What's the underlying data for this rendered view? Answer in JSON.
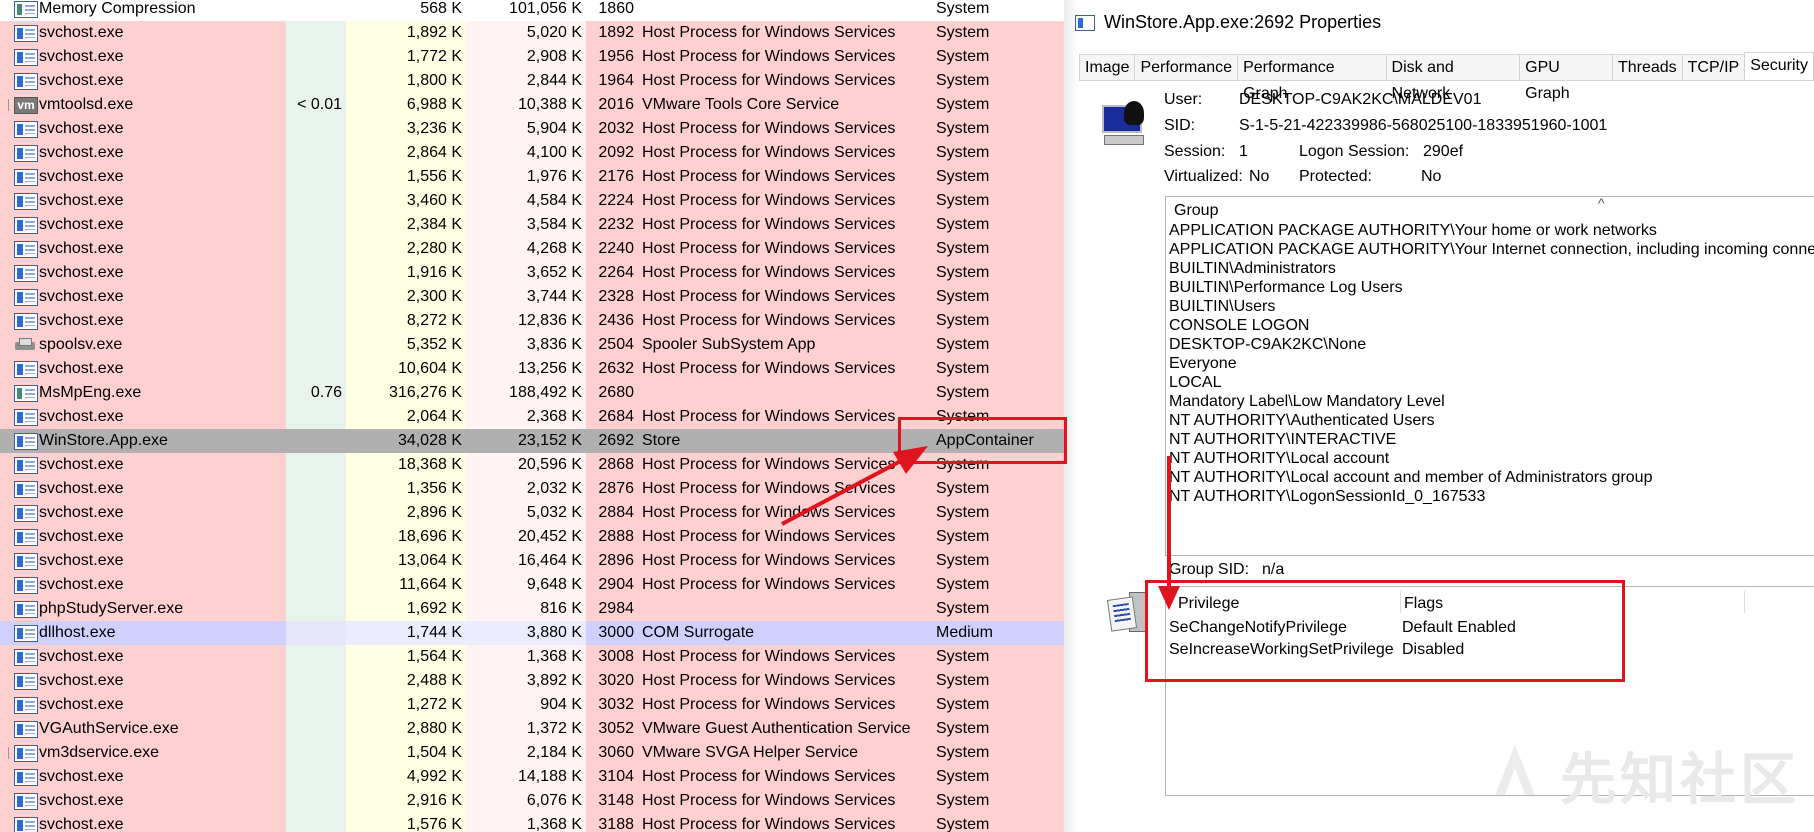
{
  "process_list": {
    "rows": [
      {
        "name": "Memory Compression",
        "cpu": "",
        "private": "568 K",
        "working_set": "101,056 K",
        "pid": "1860",
        "description": "",
        "integrity": "System",
        "style": "white",
        "icon": "plain"
      },
      {
        "name": "svchost.exe",
        "cpu": "",
        "private": "1,892 K",
        "working_set": "5,020 K",
        "pid": "1892",
        "description": "Host Process for Windows Services",
        "integrity": "System",
        "style": "pink",
        "icon": "service"
      },
      {
        "name": "svchost.exe",
        "cpu": "",
        "private": "1,772 K",
        "working_set": "2,908 K",
        "pid": "1956",
        "description": "Host Process for Windows Services",
        "integrity": "System",
        "style": "pink",
        "icon": "service"
      },
      {
        "name": "svchost.exe",
        "cpu": "",
        "private": "1,800 K",
        "working_set": "2,844 K",
        "pid": "1964",
        "description": "Host Process for Windows Services",
        "integrity": "System",
        "style": "pink",
        "icon": "service"
      },
      {
        "name": "vmtoolsd.exe",
        "cpu": "< 0.01",
        "private": "6,988 K",
        "working_set": "10,388 K",
        "pid": "2016",
        "description": "VMware Tools Core Service",
        "integrity": "System",
        "style": "pink",
        "icon": "vm",
        "tree": true
      },
      {
        "name": "svchost.exe",
        "cpu": "",
        "private": "3,236 K",
        "working_set": "5,904 K",
        "pid": "2032",
        "description": "Host Process for Windows Services",
        "integrity": "System",
        "style": "pink",
        "icon": "service"
      },
      {
        "name": "svchost.exe",
        "cpu": "",
        "private": "2,864 K",
        "working_set": "4,100 K",
        "pid": "2092",
        "description": "Host Process for Windows Services",
        "integrity": "System",
        "style": "pink",
        "icon": "service"
      },
      {
        "name": "svchost.exe",
        "cpu": "",
        "private": "1,556 K",
        "working_set": "1,976 K",
        "pid": "2176",
        "description": "Host Process for Windows Services",
        "integrity": "System",
        "style": "pink",
        "icon": "service"
      },
      {
        "name": "svchost.exe",
        "cpu": "",
        "private": "3,460 K",
        "working_set": "4,584 K",
        "pid": "2224",
        "description": "Host Process for Windows Services",
        "integrity": "System",
        "style": "pink",
        "icon": "service"
      },
      {
        "name": "svchost.exe",
        "cpu": "",
        "private": "2,384 K",
        "working_set": "3,584 K",
        "pid": "2232",
        "description": "Host Process for Windows Services",
        "integrity": "System",
        "style": "pink",
        "icon": "service"
      },
      {
        "name": "svchost.exe",
        "cpu": "",
        "private": "2,280 K",
        "working_set": "4,268 K",
        "pid": "2240",
        "description": "Host Process for Windows Services",
        "integrity": "System",
        "style": "pink",
        "icon": "service"
      },
      {
        "name": "svchost.exe",
        "cpu": "",
        "private": "1,916 K",
        "working_set": "3,652 K",
        "pid": "2264",
        "description": "Host Process for Windows Services",
        "integrity": "System",
        "style": "pink",
        "icon": "service"
      },
      {
        "name": "svchost.exe",
        "cpu": "",
        "private": "2,300 K",
        "working_set": "3,744 K",
        "pid": "2328",
        "description": "Host Process for Windows Services",
        "integrity": "System",
        "style": "pink",
        "icon": "service"
      },
      {
        "name": "svchost.exe",
        "cpu": "",
        "private": "8,272 K",
        "working_set": "12,836 K",
        "pid": "2436",
        "description": "Host Process for Windows Services",
        "integrity": "System",
        "style": "pink",
        "icon": "service"
      },
      {
        "name": "spoolsv.exe",
        "cpu": "",
        "private": "5,352 K",
        "working_set": "3,836 K",
        "pid": "2504",
        "description": "Spooler SubSystem App",
        "integrity": "System",
        "style": "pink",
        "icon": "printer"
      },
      {
        "name": "svchost.exe",
        "cpu": "",
        "private": "10,604 K",
        "working_set": "13,256 K",
        "pid": "2632",
        "description": "Host Process for Windows Services",
        "integrity": "System",
        "style": "pink",
        "icon": "service"
      },
      {
        "name": "MsMpEng.exe",
        "cpu": "0.76",
        "private": "316,276 K",
        "working_set": "188,492 K",
        "pid": "2680",
        "description": "",
        "integrity": "System",
        "style": "pink",
        "icon": "plain"
      },
      {
        "name": "svchost.exe",
        "cpu": "",
        "private": "2,064 K",
        "working_set": "2,368 K",
        "pid": "2684",
        "description": "Host Process for Windows Services",
        "integrity": "System",
        "style": "pink",
        "icon": "service"
      },
      {
        "name": "WinStore.App.exe",
        "cpu": "",
        "private": "34,028 K",
        "working_set": "23,152 K",
        "pid": "2692",
        "description": "Store",
        "integrity": "AppContainer",
        "style": "selected",
        "icon": "service"
      },
      {
        "name": "svchost.exe",
        "cpu": "",
        "private": "18,368 K",
        "working_set": "20,596 K",
        "pid": "2868",
        "description": "Host Process for Windows Services",
        "integrity": "System",
        "style": "pink",
        "icon": "service"
      },
      {
        "name": "svchost.exe",
        "cpu": "",
        "private": "1,356 K",
        "working_set": "2,032 K",
        "pid": "2876",
        "description": "Host Process for Windows Services",
        "integrity": "System",
        "style": "pink",
        "icon": "service"
      },
      {
        "name": "svchost.exe",
        "cpu": "",
        "private": "2,896 K",
        "working_set": "5,032 K",
        "pid": "2884",
        "description": "Host Process for Windows Services",
        "integrity": "System",
        "style": "pink",
        "icon": "service"
      },
      {
        "name": "svchost.exe",
        "cpu": "",
        "private": "18,696 K",
        "working_set": "20,452 K",
        "pid": "2888",
        "description": "Host Process for Windows Services",
        "integrity": "System",
        "style": "pink",
        "icon": "service"
      },
      {
        "name": "svchost.exe",
        "cpu": "",
        "private": "13,064 K",
        "working_set": "16,464 K",
        "pid": "2896",
        "description": "Host Process for Windows Services",
        "integrity": "System",
        "style": "pink",
        "icon": "service"
      },
      {
        "name": "svchost.exe",
        "cpu": "",
        "private": "11,664 K",
        "working_set": "9,648 K",
        "pid": "2904",
        "description": "Host Process for Windows Services",
        "integrity": "System",
        "style": "pink",
        "icon": "service"
      },
      {
        "name": "phpStudyServer.exe",
        "cpu": "",
        "private": "1,692 K",
        "working_set": "816 K",
        "pid": "2984",
        "description": "",
        "integrity": "System",
        "style": "pink",
        "icon": "service"
      },
      {
        "name": "dllhost.exe",
        "cpu": "",
        "private": "1,744 K",
        "working_set": "3,880 K",
        "pid": "3000",
        "description": "COM Surrogate",
        "integrity": "Medium",
        "style": "purple",
        "icon": "service"
      },
      {
        "name": "svchost.exe",
        "cpu": "",
        "private": "1,564 K",
        "working_set": "1,368 K",
        "pid": "3008",
        "description": "Host Process for Windows Services",
        "integrity": "System",
        "style": "pink",
        "icon": "service"
      },
      {
        "name": "svchost.exe",
        "cpu": "",
        "private": "2,488 K",
        "working_set": "3,892 K",
        "pid": "3020",
        "description": "Host Process for Windows Services",
        "integrity": "System",
        "style": "pink",
        "icon": "service"
      },
      {
        "name": "svchost.exe",
        "cpu": "",
        "private": "1,272 K",
        "working_set": "904 K",
        "pid": "3032",
        "description": "Host Process for Windows Services",
        "integrity": "System",
        "style": "pink",
        "icon": "service"
      },
      {
        "name": "VGAuthService.exe",
        "cpu": "",
        "private": "2,880 K",
        "working_set": "1,372 K",
        "pid": "3052",
        "description": "VMware Guest Authentication Service",
        "integrity": "System",
        "style": "pink",
        "icon": "service"
      },
      {
        "name": "vm3dservice.exe",
        "cpu": "",
        "private": "1,504 K",
        "working_set": "2,184 K",
        "pid": "3060",
        "description": "VMware SVGA Helper Service",
        "integrity": "System",
        "style": "pink",
        "icon": "service",
        "tree": true
      },
      {
        "name": "svchost.exe",
        "cpu": "",
        "private": "4,992 K",
        "working_set": "14,188 K",
        "pid": "3104",
        "description": "Host Process for Windows Services",
        "integrity": "System",
        "style": "pink",
        "icon": "service"
      },
      {
        "name": "svchost.exe",
        "cpu": "",
        "private": "2,916 K",
        "working_set": "6,076 K",
        "pid": "3148",
        "description": "Host Process for Windows Services",
        "integrity": "System",
        "style": "pink",
        "icon": "service"
      },
      {
        "name": "svchost.exe",
        "cpu": "",
        "private": "1,576 K",
        "working_set": "1,368 K",
        "pid": "3188",
        "description": "Host Process for Windows Services",
        "integrity": "System",
        "style": "pink",
        "icon": "service"
      }
    ]
  },
  "properties": {
    "title": "WinStore.App.exe:2692 Properties",
    "tabs": [
      "Image",
      "Performance",
      "Performance Graph",
      "Disk and Network",
      "GPU Graph",
      "Threads",
      "TCP/IP",
      "Security"
    ],
    "active_tab": "Security",
    "user_label": "User:",
    "user_value": "DESKTOP-C9AK2KC\\MALDEV01",
    "sid_label": "SID:",
    "sid_value": "S-1-5-21-422339986-568025100-1833951960-1001",
    "session_label": "Session:",
    "session_value": "1",
    "logon_session_label": "Logon Session:",
    "logon_session_value": "290ef",
    "virtualized_label": "Virtualized:",
    "virtualized_value": "No",
    "protected_label": "Protected:",
    "protected_value": "No",
    "group_header": "Group",
    "groups": [
      "APPLICATION PACKAGE AUTHORITY\\Your home or work networks",
      "APPLICATION PACKAGE AUTHORITY\\Your Internet connection, including incoming conne",
      "BUILTIN\\Administrators",
      "BUILTIN\\Performance Log Users",
      "BUILTIN\\Users",
      "CONSOLE LOGON",
      "DESKTOP-C9AK2KC\\None",
      "Everyone",
      "LOCAL",
      "Mandatory Label\\Low Mandatory Level",
      "NT AUTHORITY\\Authenticated Users",
      "NT AUTHORITY\\INTERACTIVE",
      "NT AUTHORITY\\Local account",
      "NT AUTHORITY\\Local account and member of Administrators group",
      "NT AUTHORITY\\LogonSessionId_0_167533"
    ],
    "group_sid_label": "Group SID:",
    "group_sid_value": "n/a",
    "privilege_header": "Privilege",
    "flags_header": "Flags",
    "privileges": [
      {
        "name": "SeChangeNotifyPrivilege",
        "flags": "Default Enabled"
      },
      {
        "name": "SeIncreaseWorkingSetPrivilege",
        "flags": "Disabled"
      }
    ]
  },
  "watermark": "先知社区",
  "colors": {
    "annotation_red": "#e0141e",
    "service_row": "#ffd0d0",
    "user_row": "#d0d0ff",
    "selected_row": "#b0b0b0"
  }
}
